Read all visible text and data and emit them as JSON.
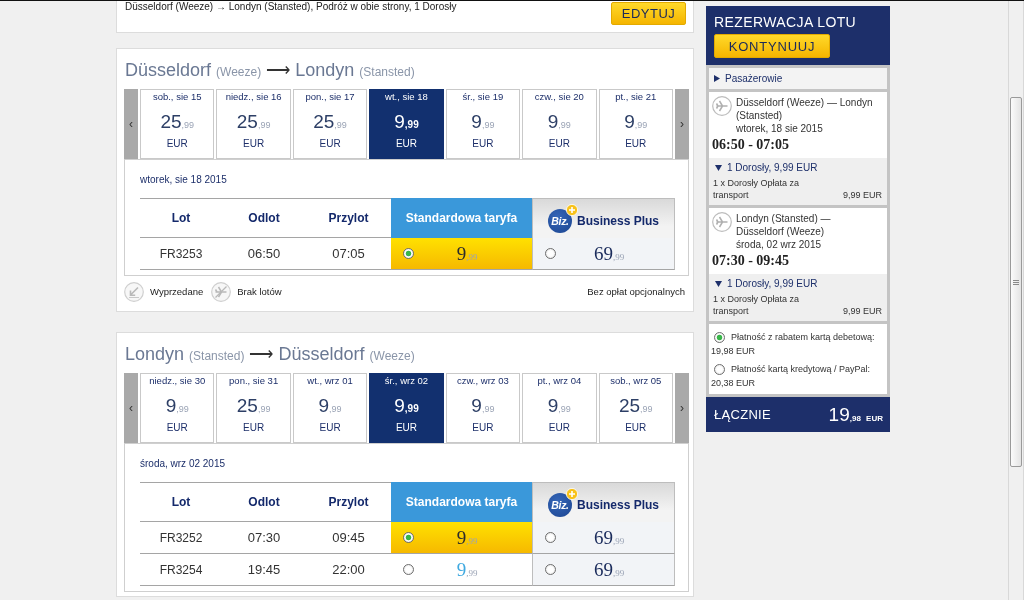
{
  "summary": {
    "text": "Düsseldorf (Weeze) → Londyn (Stansted), Podróż w obie strony, 1 Dorosły",
    "edit_button": "EDYTUJ"
  },
  "journeys": [
    {
      "origin": "Düsseldorf",
      "origin_airport": "(Weeze)",
      "arrow": "⟶",
      "destination": "Londyn",
      "destination_airport": "(Stansted)",
      "prev": "‹",
      "next": "›",
      "dates": [
        {
          "label": "sob., sie 15",
          "amount": "25",
          "decimals": ",99",
          "currency": "EUR",
          "selected": false
        },
        {
          "label": "niedz., sie 16",
          "amount": "25",
          "decimals": ",99",
          "currency": "EUR",
          "selected": false
        },
        {
          "label": "pon., sie 17",
          "amount": "25",
          "decimals": ",99",
          "currency": "EUR",
          "selected": false
        },
        {
          "label": "wt., sie 18",
          "amount": "9",
          "decimals": ",99",
          "currency": "EUR",
          "selected": true
        },
        {
          "label": "śr., sie 19",
          "amount": "9",
          "decimals": ",99",
          "currency": "EUR",
          "selected": false
        },
        {
          "label": "czw., sie 20",
          "amount": "9",
          "decimals": ",99",
          "currency": "EUR",
          "selected": false
        },
        {
          "label": "pt., sie 21",
          "amount": "9",
          "decimals": ",99",
          "currency": "EUR",
          "selected": false
        }
      ],
      "day_heading": "wtorek, sie 18 2015",
      "columns": [
        "Lot",
        "Odlot",
        "Przylot"
      ],
      "fare_columns": [
        {
          "kind": "standard",
          "label": "Standardowa taryfa"
        },
        {
          "kind": "business",
          "label": "Business Plus",
          "logo": "Biz."
        }
      ],
      "flights": [
        {
          "number": "FR3253",
          "departure": "06:50",
          "arrival": "07:05",
          "fares": [
            {
              "amount": "9",
              "decimals": ",99",
              "selected": true
            },
            {
              "amount": "69",
              "decimals": ",99",
              "selected": false
            }
          ]
        }
      ],
      "legend": [
        {
          "kind": "sold_out",
          "label": "Wyprzedane"
        },
        {
          "kind": "no_flights",
          "label": "Brak lotów"
        }
      ],
      "note": "Bez opłat opcjonalnych"
    },
    {
      "origin": "Londyn",
      "origin_airport": "(Stansted)",
      "arrow": "⟶",
      "destination": "Düsseldorf",
      "destination_airport": "(Weeze)",
      "prev": "‹",
      "next": "›",
      "dates": [
        {
          "label": "niedz., sie 30",
          "amount": "9",
          "decimals": ",99",
          "currency": "EUR",
          "selected": false
        },
        {
          "label": "pon., sie 31",
          "amount": "25",
          "decimals": ",99",
          "currency": "EUR",
          "selected": false
        },
        {
          "label": "wt., wrz 01",
          "amount": "9",
          "decimals": ",99",
          "currency": "EUR",
          "selected": false
        },
        {
          "label": "śr., wrz 02",
          "amount": "9",
          "decimals": ",99",
          "currency": "EUR",
          "selected": true
        },
        {
          "label": "czw., wrz 03",
          "amount": "9",
          "decimals": ",99",
          "currency": "EUR",
          "selected": false
        },
        {
          "label": "pt., wrz 04",
          "amount": "9",
          "decimals": ",99",
          "currency": "EUR",
          "selected": false
        },
        {
          "label": "sob., wrz 05",
          "amount": "25",
          "decimals": ",99",
          "currency": "EUR",
          "selected": false
        }
      ],
      "day_heading": "środa, wrz 02 2015",
      "columns": [
        "Lot",
        "Odlot",
        "Przylot"
      ],
      "fare_columns": [
        {
          "kind": "standard",
          "label": "Standardowa taryfa"
        },
        {
          "kind": "business",
          "label": "Business Plus",
          "logo": "Biz."
        }
      ],
      "flights": [
        {
          "number": "FR3252",
          "departure": "07:30",
          "arrival": "09:45",
          "fares": [
            {
              "amount": "9",
              "decimals": ",99",
              "selected": true
            },
            {
              "amount": "69",
              "decimals": ",99",
              "selected": false
            }
          ]
        },
        {
          "number": "FR3254",
          "departure": "19:45",
          "arrival": "22:00",
          "fares": [
            {
              "amount": "9",
              "decimals": ",99",
              "selected": false
            },
            {
              "amount": "69",
              "decimals": ",99",
              "selected": false
            }
          ]
        }
      ]
    }
  ],
  "booking": {
    "title": "REZERWACJA LOTU",
    "continue_button": "KONTYNUUJ",
    "passengers": {
      "label": "Pasażerowie",
      "expanded": false
    },
    "flights": [
      {
        "route": "Düsseldorf (Weeze) — Londyn (Stansted)",
        "date": "wtorek, 18 sie 2015",
        "time": "06:50 - 07:05",
        "fare": {
          "label": "1 Dorosły, 9,99 EUR",
          "expanded": true,
          "item": "1 x Dorosły Opłata za transport",
          "amount": "9,99 EUR"
        }
      },
      {
        "route": "Londyn (Stansted) — Düsseldorf (Weeze)",
        "date": "środa, 02 wrz 2015",
        "time": "07:30 - 09:45",
        "fare": {
          "label": "1 Dorosły, 9,99 EUR",
          "expanded": true,
          "item": "1 x Dorosły Opłata za transport",
          "amount": "9,99 EUR"
        }
      }
    ],
    "payments": [
      {
        "label": "Płatność z rabatem kartą debetową:",
        "amount": "19,98 EUR",
        "selected": true
      },
      {
        "label": "Płatność kartą kredytową / PayPal:",
        "amount": "20,38 EUR",
        "selected": false
      }
    ],
    "total": {
      "label": "ŁĄCZNIE",
      "amount": "19",
      "decimals": ",98",
      "currency": "EUR"
    }
  }
}
